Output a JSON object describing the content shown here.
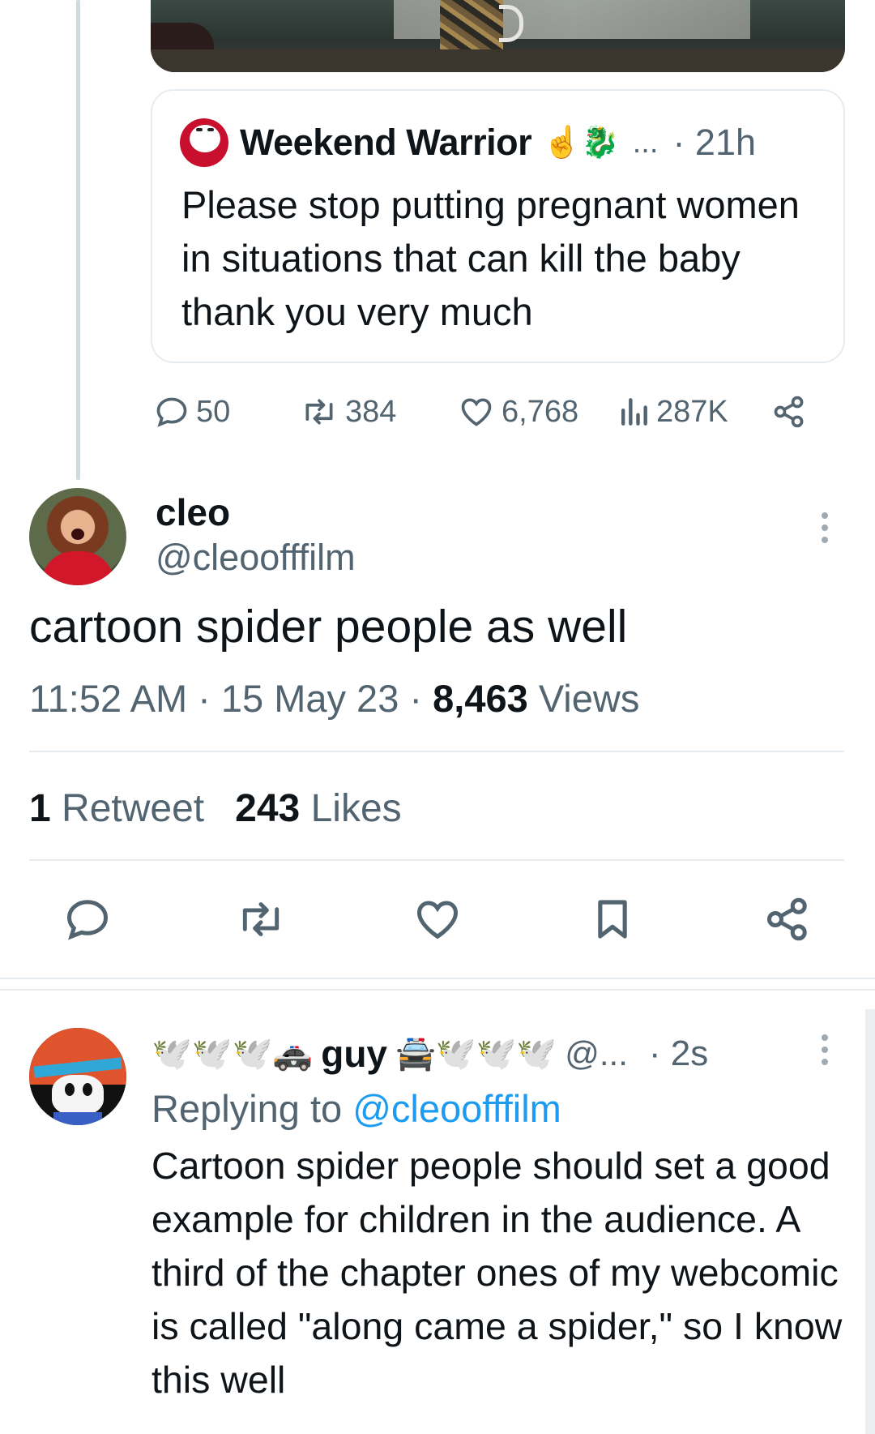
{
  "quoted_tweet": {
    "author_name": "Weekend Warrior",
    "name_emojis": "☝️🐉",
    "more": "...",
    "time": "· 21h",
    "text": "Please stop putting pregnant women in situations that can kill the baby thank you very much",
    "stats": {
      "replies": "50",
      "retweets": "384",
      "likes": "6,768",
      "views": "287K"
    }
  },
  "main_tweet": {
    "author_name": "cleo",
    "author_handle": "@cleoofffilm",
    "text": "cartoon spider people as well",
    "time": "11:52 AM",
    "date": "15 May 23",
    "views_count": "8,463",
    "views_label": "Views",
    "retweets_count": "1",
    "retweets_label": "Retweet",
    "likes_count": "243",
    "likes_label": "Likes"
  },
  "reply_tweet": {
    "name_prefix_emojis": "🕊️🕊️🕊️🚓",
    "author_name": "guy",
    "name_suffix_emojis": "🚔🕊️🕊️🕊️",
    "author_handle": "@...",
    "time": "· 2s",
    "replying_label": "Replying to",
    "replying_to": "@cleoofffilm",
    "text": "Cartoon spider people should set a good example for children in the audience. A third of the chapter ones of my webcomic is called \"along came a spider,\" so I know this well"
  },
  "colors": {
    "text_primary": "#0f1419",
    "text_secondary": "#536471",
    "link": "#1d9bf0",
    "border": "#e6ecf0"
  },
  "icons": [
    "reply-icon",
    "retweet-icon",
    "like-icon",
    "views-icon",
    "share-icon",
    "bookmark-icon",
    "more-icon"
  ]
}
